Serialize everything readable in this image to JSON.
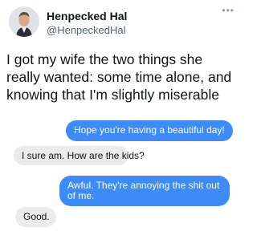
{
  "author": {
    "display_name": "Henpecked Hal",
    "handle": "@HenpeckedHal",
    "avatar_icon": "profile-avatar",
    "more_icon": "more-options-icon"
  },
  "tweet": {
    "text": "I got my wife the two things she really wanted: some time alone, and knowing that I'm slightly miserable"
  },
  "messages": [
    {
      "direction": "sent",
      "text": "Hope you're having a beautiful day!"
    },
    {
      "direction": "received",
      "text": "I sure am. How are the kids?"
    },
    {
      "direction": "sent",
      "text": "Awful. They're annoying the shit out of me."
    },
    {
      "direction": "received",
      "text": "Good."
    }
  ],
  "colors": {
    "sent_bubble": "#3c8bf7",
    "received_bubble": "#ebebee",
    "text_primary": "#0f1419",
    "text_secondary": "#536471"
  }
}
